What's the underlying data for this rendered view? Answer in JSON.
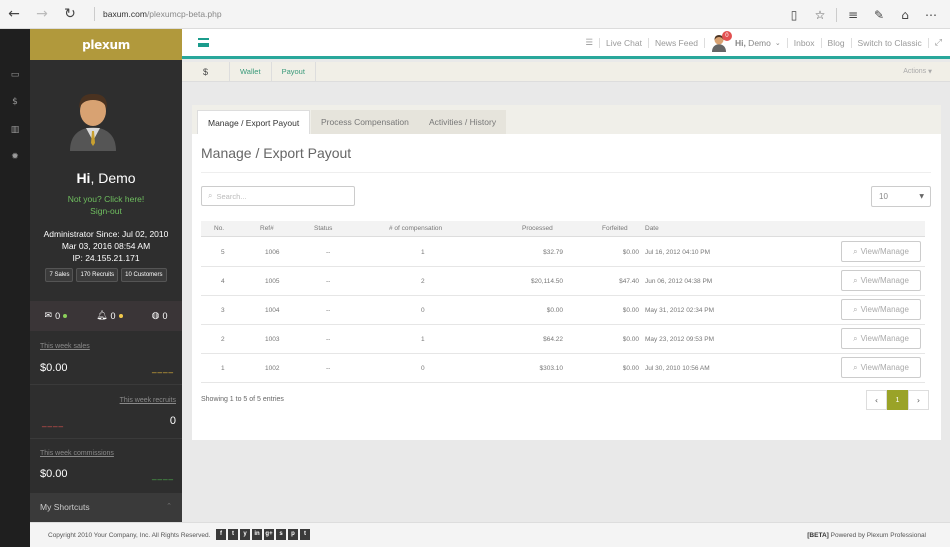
{
  "browser": {
    "url_host": "baxum.com",
    "url_path": "/plexumcp-beta.php"
  },
  "sidebar": {
    "logo": "plexum",
    "greeting_prefix": "Hi",
    "greeting_name": ", Demo",
    "not_you": "Not you? Click here!",
    "sign_out": "Sign-out",
    "admin_since": "Administrator Since: Jul 02, 2010",
    "last_login": "Mar 03, 2016 08:54 AM",
    "ip": "IP: 24.155.21.171",
    "pills": [
      "7 Sales",
      "170 Recruits",
      "10 Customers"
    ],
    "notifications": [
      {
        "icon": "mail-icon",
        "count": "0",
        "dot": "#8bd05a"
      },
      {
        "icon": "bell-icon",
        "count": "0",
        "dot": "#f2c94c"
      },
      {
        "icon": "globe-icon",
        "count": "0"
      }
    ],
    "stats": [
      {
        "label": "This week sales",
        "value": "$0.00",
        "color": "#e0b43a"
      },
      {
        "label": "This week recruits",
        "value": "0",
        "color": "#d9534f"
      },
      {
        "label": "This week commissions",
        "value": "$0.00",
        "color": "#4cae4c"
      }
    ],
    "shortcuts": "My Shortcuts"
  },
  "topbar": {
    "live_chat": "Live Chat",
    "news_feed": "News Feed",
    "badge": "0",
    "hi": "Hi,",
    "user": " Demo",
    "inbox": "Inbox",
    "blog": "Blog",
    "switch": "Switch to Classic"
  },
  "subnav": {
    "dollar": "$",
    "wallet": "Wallet",
    "payout": "Payout",
    "actions": "Actions"
  },
  "tabs": [
    "Manage / Export Payout",
    "Process Compensation",
    "Activities / History"
  ],
  "page_title": "Manage / Export Payout",
  "search_placeholder": "Search...",
  "page_size": "10",
  "table": {
    "headers": [
      "No.",
      "Ref#",
      "Status",
      "# of compensation",
      "Processed",
      "Forfeited",
      "Date"
    ],
    "rows": [
      {
        "no": "5",
        "ref": "1006",
        "status": "--",
        "comp": "1",
        "processed": "$32.79",
        "forfeited": "$0.00",
        "date": "Jul 16, 2012 04:10 PM"
      },
      {
        "no": "4",
        "ref": "1005",
        "status": "--",
        "comp": "2",
        "processed": "$20,114.50",
        "forfeited": "$47.40",
        "date": "Jun 06, 2012 04:38 PM"
      },
      {
        "no": "3",
        "ref": "1004",
        "status": "--",
        "comp": "0",
        "processed": "$0.00",
        "forfeited": "$0.00",
        "date": "May 31, 2012 02:34 PM"
      },
      {
        "no": "2",
        "ref": "1003",
        "status": "--",
        "comp": "1",
        "processed": "$64.22",
        "forfeited": "$0.00",
        "date": "May 23, 2012 09:53 PM"
      },
      {
        "no": "1",
        "ref": "1002",
        "status": "--",
        "comp": "0",
        "processed": "$303.10",
        "forfeited": "$0.00",
        "date": "Jul 30, 2010 10:56 AM"
      }
    ],
    "button_label": "View/Manage"
  },
  "showing": "Showing 1 to 5 of 5 entries",
  "pager": {
    "current": "1"
  },
  "footer": {
    "copyright": "Copyright 2010 Your Company, Inc. All Rights Reserved.",
    "beta": "[BETA]",
    "powered": " Powered by Plexum Professional",
    "social": [
      "f",
      "t",
      "y",
      "in",
      "g+",
      "s",
      "p",
      "t"
    ]
  }
}
